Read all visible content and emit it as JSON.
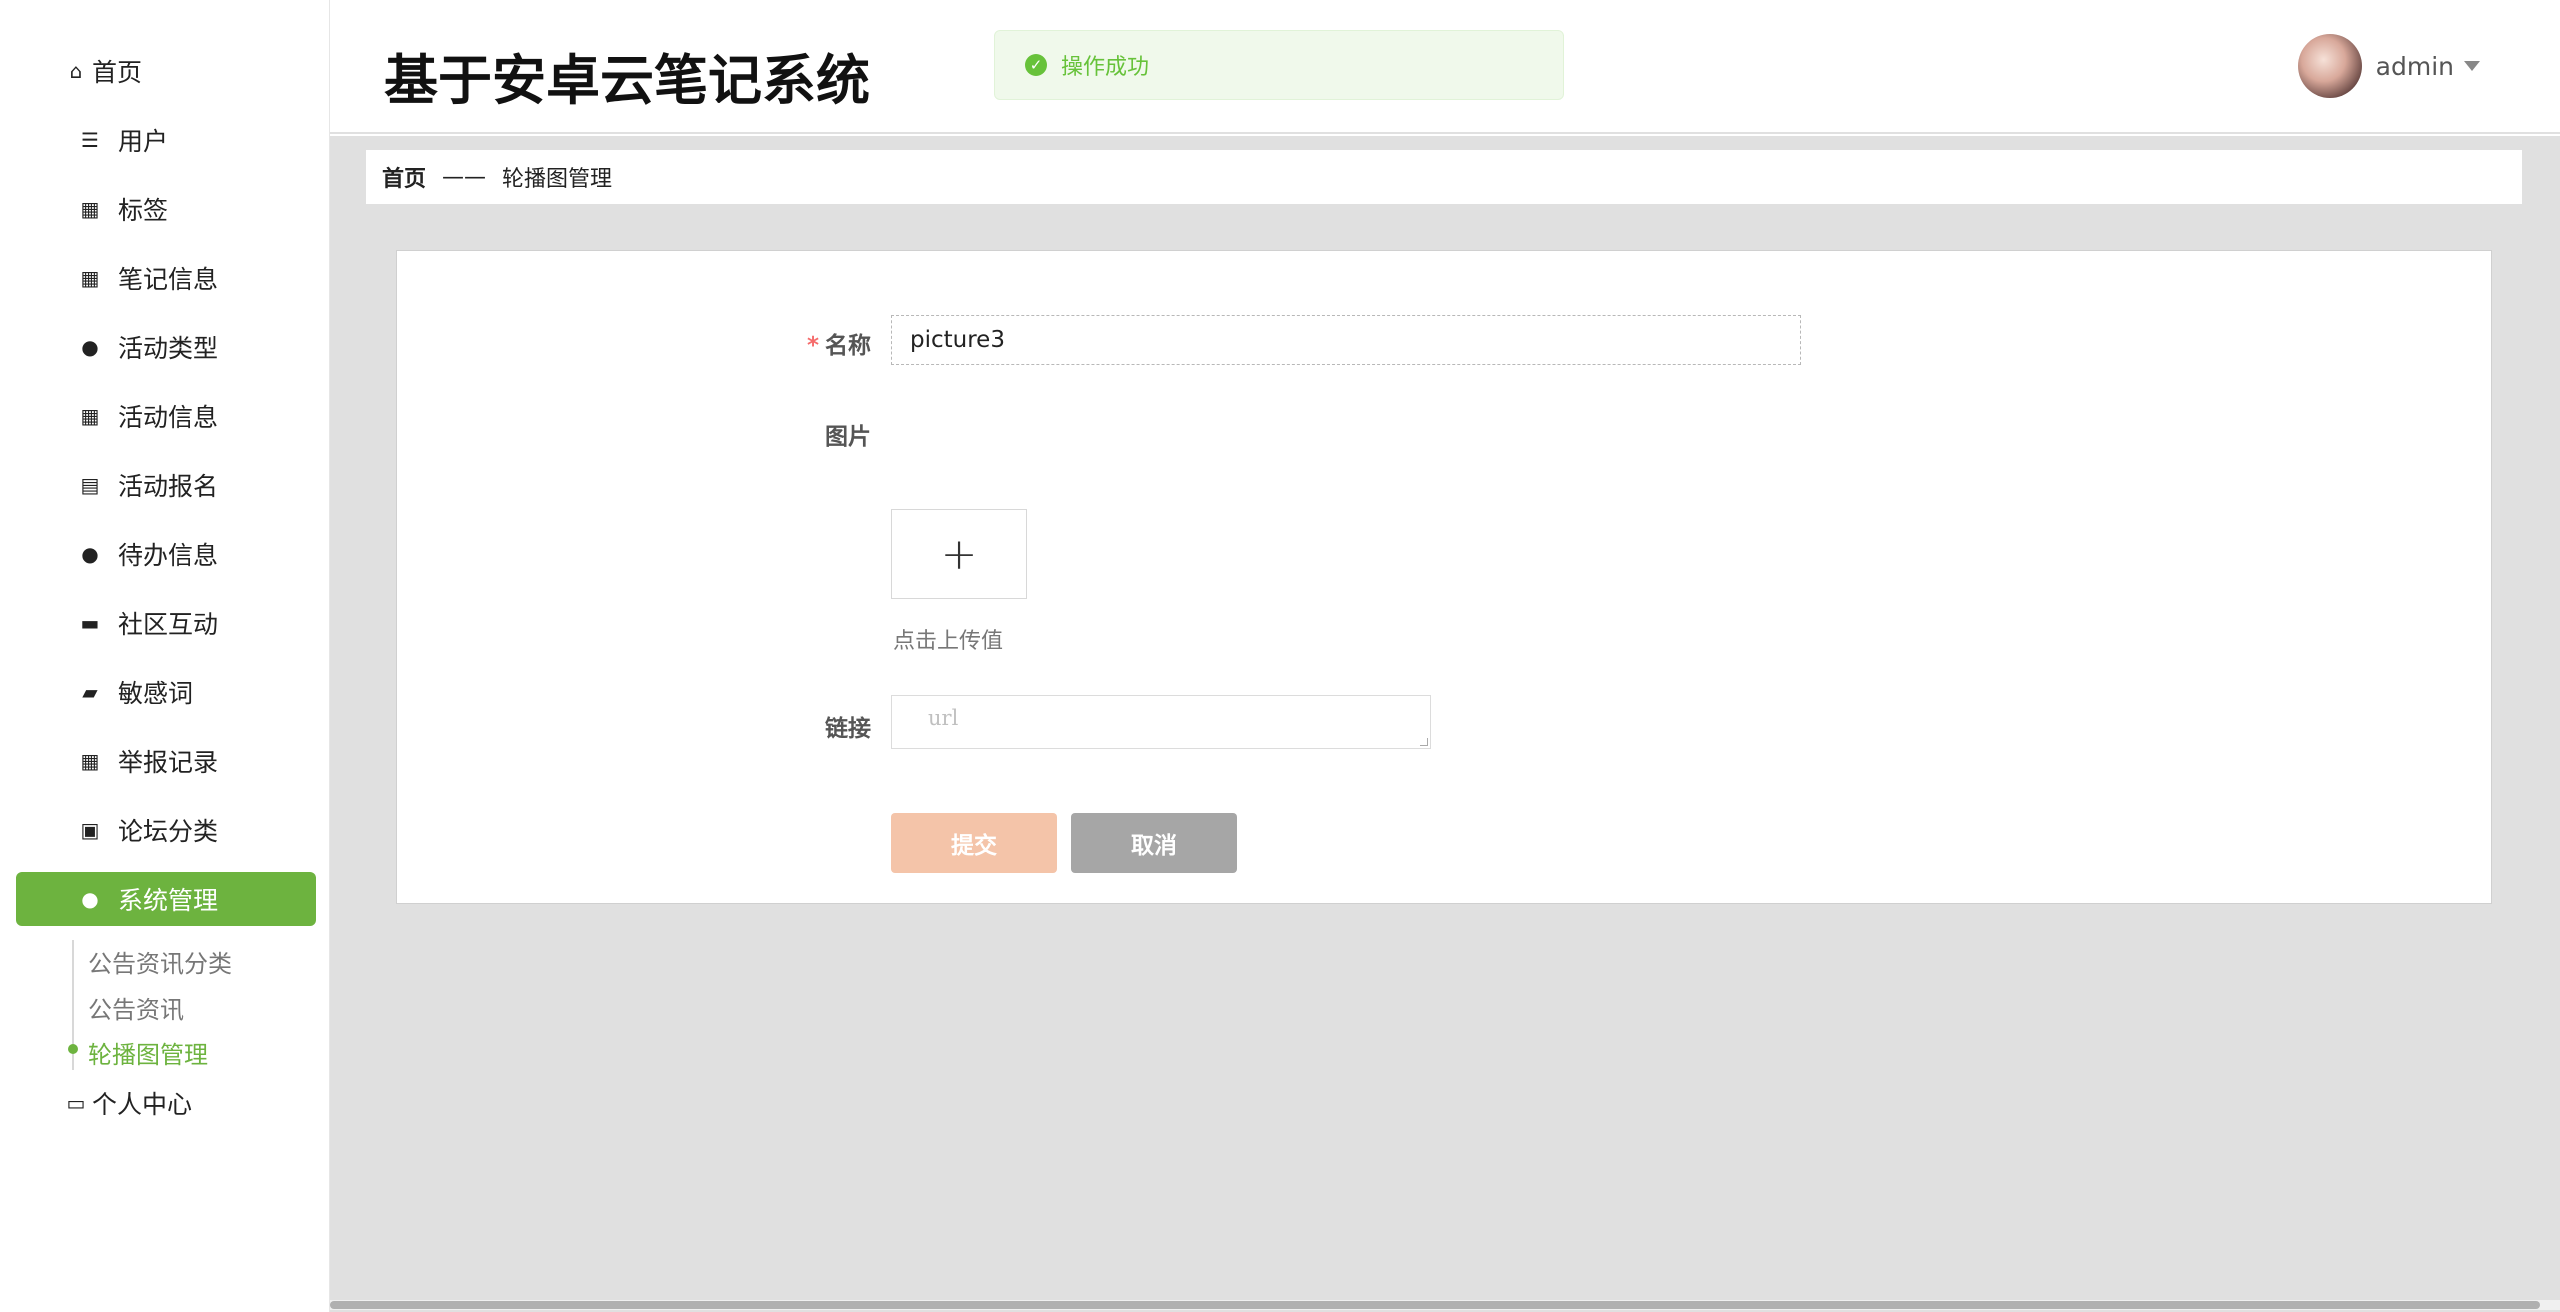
{
  "header": {
    "title": "基于安卓云笔记系统",
    "toast": "操作成功",
    "user": "admin"
  },
  "sidebar": {
    "home": "首页",
    "items": [
      {
        "label": "用户",
        "icon": "list-icon"
      },
      {
        "label": "标签",
        "icon": "grid-icon"
      },
      {
        "label": "笔记信息",
        "icon": "grid-icon"
      },
      {
        "label": "活动类型",
        "icon": "user-icon"
      },
      {
        "label": "活动信息",
        "icon": "grid-icon"
      },
      {
        "label": "活动报名",
        "icon": "clipboard-icon"
      },
      {
        "label": "待办信息",
        "icon": "bulb-icon"
      },
      {
        "label": "社区互动",
        "icon": "brush-icon"
      },
      {
        "label": "敏感词",
        "icon": "wallet-icon"
      },
      {
        "label": "举报记录",
        "icon": "grid-icon"
      },
      {
        "label": "论坛分类",
        "icon": "briefcase-icon"
      },
      {
        "label": "系统管理",
        "icon": "user-icon"
      }
    ],
    "sub_items": [
      "公告资讯分类",
      "公告资讯",
      "轮播图管理"
    ],
    "personal": "个人中心"
  },
  "breadcrumb": {
    "home": "首页",
    "sep": "——",
    "current": "轮播图管理"
  },
  "form": {
    "name_label": "名称",
    "name_value": "picture3",
    "image_label": "图片",
    "upload_plus": "+",
    "upload_tip": "点击上传值",
    "link_label": "链接",
    "link_placeholder": "url",
    "submit": "提交",
    "cancel": "取消"
  },
  "colors": {
    "accent": "#6db33f",
    "toast_bg": "#f0f9eb",
    "submit_bg": "#f4c4a9",
    "cancel_bg": "#a6a6a6"
  }
}
